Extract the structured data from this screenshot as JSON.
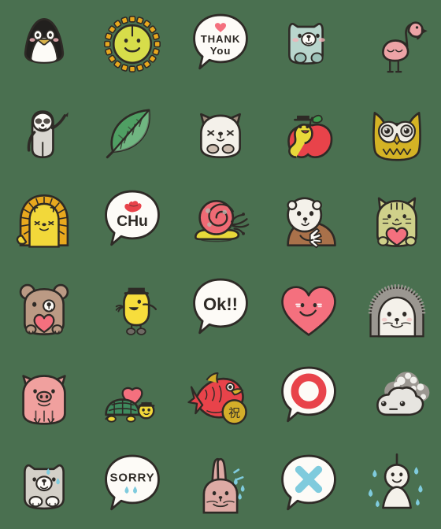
{
  "page": {
    "title": "Emoji Sticker Set",
    "background_color": "#4a7050",
    "grid": {
      "columns": 5,
      "rows": 6,
      "cell_size_px": 112,
      "total_stickers": 30
    }
  },
  "palette": {
    "outline": "#2e2a26",
    "white": "#fdfbf7",
    "off_white": "#efece4",
    "red": "#e8434a",
    "pink_heart": "#f4707e",
    "pink_flamingo": "#eda3a6",
    "pink_pig": "#f0a09e",
    "pink_rabbit": "#ddaaa4",
    "yellow": "#f2d83a",
    "yellow_chick": "#f7dd3c",
    "gold": "#d4ae2a",
    "olive": "#cfd08a",
    "green_leaf": "#4f9f63",
    "green_dark": "#2f7a49",
    "mint": "#b9d6cd",
    "brown": "#a9795a",
    "brown_light": "#bb9a84",
    "gray": "#b7b4ae",
    "gray_dark": "#8d8a85",
    "blue_drop": "#7fcbdd"
  },
  "stickers": [
    {
      "row": 1,
      "col": 1,
      "id": "penguin",
      "name": "penguin",
      "label": "Penguin",
      "text": "",
      "colors": {
        "body": "#22201e",
        "belly": "#fdfbf7",
        "beak": "#d9b24a",
        "cheek": "#f2b3b8"
      }
    },
    {
      "row": 1,
      "col": 2,
      "id": "sun-flower",
      "name": "smiling-sun",
      "label": "Smiling sun",
      "text": "",
      "colors": {
        "body": "#d7dd4a",
        "rays": "#e8a81e"
      }
    },
    {
      "row": 1,
      "col": 3,
      "id": "thank-you",
      "name": "thank-you-speech-bubble",
      "label": "Thank You bubble",
      "text": "THANK You",
      "line1": "THANK",
      "line2": "You",
      "colors": {
        "bubble": "#fdfbf7",
        "heart": "#f4707e"
      }
    },
    {
      "row": 1,
      "col": 4,
      "id": "mint-dog",
      "name": "mint-dog",
      "label": "Mint puppy",
      "text": "",
      "colors": {
        "body": "#b9d6cd",
        "muzzle": "#fdfbf7",
        "cheek": "#f2b3b8"
      }
    },
    {
      "row": 1,
      "col": 5,
      "id": "flamingo",
      "name": "flamingo",
      "label": "Flamingo",
      "text": "",
      "colors": {
        "body": "#eda3a6",
        "beak": "#2e2a26",
        "legs": "#2e2a26"
      }
    },
    {
      "row": 2,
      "col": 1,
      "id": "sloth",
      "name": "waving-sloth",
      "label": "Waving sloth",
      "text": "",
      "colors": {
        "body": "#d9d6d0",
        "face": "#fdfbf7",
        "mask": "#55504a"
      }
    },
    {
      "row": 2,
      "col": 2,
      "id": "leaf",
      "name": "green-leaf",
      "label": "Green leaf",
      "text": "",
      "colors": {
        "light": "#8cc89a",
        "mid": "#4f9f63",
        "dark": "#2f7a49"
      }
    },
    {
      "row": 2,
      "col": 3,
      "id": "sleepy-cat",
      "name": "sleepy-cat",
      "label": "Sleepy cat",
      "text": "",
      "colors": {
        "body": "#f4f1ea",
        "ears": "#a08d7e",
        "paws": "#cdbdb0"
      }
    },
    {
      "row": 2,
      "col": 4,
      "id": "worm-apple",
      "name": "caterpillar-with-apple",
      "label": "Caterpillar and apple",
      "text": "",
      "colors": {
        "worm": "#e8d93a",
        "apple": "#e8434a",
        "leaf": "#3f9b4e",
        "hat": "#2e2a26"
      }
    },
    {
      "row": 2,
      "col": 5,
      "id": "owl",
      "name": "owl",
      "label": "Owl",
      "text": "",
      "colors": {
        "body": "#d4b325",
        "face": "#efece4",
        "beak": "#d4ae2a"
      }
    },
    {
      "row": 3,
      "col": 1,
      "id": "lion",
      "name": "lion",
      "label": "Lion",
      "text": "",
      "colors": {
        "mane": "#e8a81e",
        "face": "#f2d83a"
      }
    },
    {
      "row": 3,
      "col": 2,
      "id": "chu",
      "name": "chu-kiss-speech-bubble",
      "label": "Chu bubble",
      "text": "CHu",
      "colors": {
        "bubble": "#fdfbf7",
        "lips": "#e8434a"
      }
    },
    {
      "row": 3,
      "col": 3,
      "id": "snail",
      "name": "snail",
      "label": "Snail",
      "text": "",
      "colors": {
        "shell": "#ef6a74",
        "body": "#e8d93a"
      }
    },
    {
      "row": 3,
      "col": 4,
      "id": "otter",
      "name": "sea-otter-with-shell",
      "label": "Sea otter",
      "text": "",
      "colors": {
        "head": "#f4f1ea",
        "body": "#a9714a",
        "shell": "#fdfbf7"
      }
    },
    {
      "row": 3,
      "col": 5,
      "id": "cat-heart",
      "name": "cat-holding-heart",
      "label": "Cat with heart",
      "text": "",
      "colors": {
        "body": "#cfd08a",
        "heart": "#f4707e"
      }
    },
    {
      "row": 4,
      "col": 1,
      "id": "bear-heart",
      "name": "bear-holding-heart",
      "label": "Bear with heart",
      "text": "",
      "colors": {
        "body": "#bb9a84",
        "muzzle": "#fdfbf7",
        "heart": "#f4707e"
      }
    },
    {
      "row": 4,
      "col": 2,
      "id": "chick-hat",
      "name": "chick-with-top-hat",
      "label": "Chick in top hat",
      "text": "",
      "colors": {
        "body": "#f7dd3c",
        "hat": "#2e2a26"
      }
    },
    {
      "row": 4,
      "col": 3,
      "id": "ok",
      "name": "ok-speech-bubble",
      "label": "OK bubble",
      "text": "Ok!!",
      "colors": {
        "bubble": "#fdfbf7",
        "ink": "#2e2a26"
      }
    },
    {
      "row": 4,
      "col": 4,
      "id": "heart-face",
      "name": "smiling-heart",
      "label": "Smiling heart",
      "text": "",
      "colors": {
        "heart": "#f4707e",
        "cheek": "#ffffff"
      }
    },
    {
      "row": 4,
      "col": 5,
      "id": "hedgehog",
      "name": "hedgehog",
      "label": "Hedgehog",
      "text": "",
      "colors": {
        "spines": "#9b9791",
        "face": "#f4f1ea"
      }
    },
    {
      "row": 5,
      "col": 1,
      "id": "pig",
      "name": "pig",
      "label": "Pig",
      "text": "",
      "colors": {
        "body": "#f0a09e",
        "snout": "#e08f8d"
      }
    },
    {
      "row": 5,
      "col": 2,
      "id": "turtle-heart",
      "name": "turtle-with-heart",
      "label": "Turtle with heart",
      "text": "",
      "colors": {
        "shell": "#3f8a5e",
        "head": "#f2d83a",
        "heart": "#f4707e",
        "hat": "#2e2a26"
      }
    },
    {
      "row": 5,
      "col": 3,
      "id": "sea-bream",
      "name": "celebration-sea-bream",
      "label": "Sea bream with 祝 coin",
      "text": "祝",
      "colors": {
        "fish": "#e8434a",
        "coin": "#d4ae2a",
        "fins": "#d4ae2a"
      }
    },
    {
      "row": 5,
      "col": 4,
      "id": "maru",
      "name": "circle-correct-speech-bubble",
      "label": "Circle (correct) bubble",
      "text": "",
      "colors": {
        "bubble": "#fdfbf7",
        "mark": "#e8434a"
      }
    },
    {
      "row": 5,
      "col": 5,
      "id": "rain-cloud",
      "name": "gray-rain-cloud",
      "label": "Gray cloud",
      "text": "",
      "colors": {
        "cloud": "#e7e5e0",
        "dark": "#9b9791"
      }
    },
    {
      "row": 6,
      "col": 1,
      "id": "sweating-dog",
      "name": "sweating-dog",
      "label": "Sweating dog",
      "text": "",
      "colors": {
        "body": "#d4d0c8",
        "muzzle": "#fdfbf7",
        "drop": "#7fcbdd"
      }
    },
    {
      "row": 6,
      "col": 2,
      "id": "sorry",
      "name": "sorry-speech-bubble",
      "label": "Sorry bubble",
      "text": "SORRY",
      "colors": {
        "bubble": "#fdfbf7",
        "ink": "#2e2a26",
        "drop": "#7fcbdd"
      }
    },
    {
      "row": 6,
      "col": 3,
      "id": "rabbit",
      "name": "startled-rabbit",
      "label": "Startled rabbit",
      "text": "",
      "colors": {
        "body": "#ddaaa4",
        "drop": "#7fcbdd"
      }
    },
    {
      "row": 6,
      "col": 4,
      "id": "batsu",
      "name": "cross-incorrect-speech-bubble",
      "label": "Cross (incorrect) bubble",
      "text": "",
      "colors": {
        "bubble": "#fdfbf7",
        "mark": "#7fcbdd"
      }
    },
    {
      "row": 6,
      "col": 5,
      "id": "teru-bozu",
      "name": "teru-teru-bozu-in-rain",
      "label": "Teru teru bozu in rain",
      "text": "",
      "colors": {
        "body": "#f4f1ea",
        "drop": "#7fcbdd"
      }
    }
  ]
}
